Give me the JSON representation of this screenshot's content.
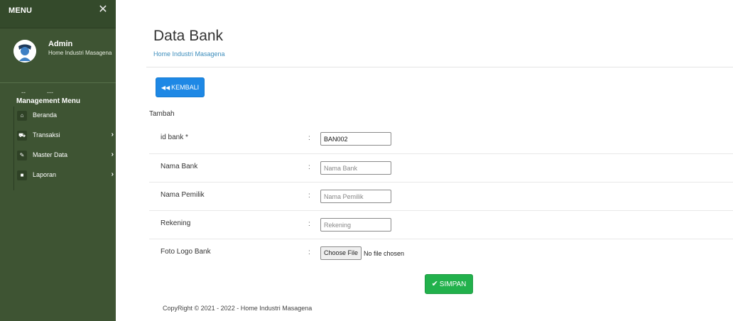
{
  "sidebar": {
    "menu_title": "MENU",
    "close_glyph": "✕",
    "user": {
      "name": "Admin",
      "subtitle": "Home Industri Masagena",
      "avatar_icon": "user-avatar-icon"
    },
    "dots_left": "--",
    "dots_right": "---",
    "section_title": "Management Menu",
    "items": [
      {
        "label": "Beranda",
        "icon": "home-icon",
        "glyph": "⌂",
        "has_arrow": false
      },
      {
        "label": "Transaksi",
        "icon": "cart-icon",
        "glyph": "⛟",
        "has_arrow": true
      },
      {
        "label": "Master Data",
        "icon": "edit-icon",
        "glyph": "✎",
        "has_arrow": true
      },
      {
        "label": "Laporan",
        "icon": "folder-icon",
        "glyph": "■",
        "has_arrow": true
      }
    ],
    "arrow_glyph": "›"
  },
  "header": {
    "title": "Data Bank",
    "subtitle": "Home Industri Masagena"
  },
  "toolbar": {
    "back_label": "KEMBALI",
    "back_glyph": "◀◀"
  },
  "form": {
    "section_label": "Tambah",
    "colon": ":",
    "fields": {
      "id_bank": {
        "label": "id bank *",
        "value": "BAN002",
        "placeholder": ""
      },
      "nama_bank": {
        "label": "Nama Bank",
        "value": "",
        "placeholder": "Nama Bank"
      },
      "nama_pemilik": {
        "label": "Nama Pemilik",
        "value": "",
        "placeholder": "Nama Pemilik"
      },
      "rekening": {
        "label": "Rekening",
        "value": "",
        "placeholder": "Rekening"
      },
      "foto_logo": {
        "label": "Foto Logo Bank",
        "button": "Choose File",
        "status": "No file chosen"
      }
    },
    "save_label": "SIMPAN",
    "save_glyph": "✔"
  },
  "footer": {
    "text": "CopyRight © 2021 - 2022 - Home Industri Masagena"
  },
  "colors": {
    "sidebar_bg": "#3e5433",
    "primary": "#1e88e5",
    "success": "#22b14c",
    "link": "#3c8dbc"
  }
}
